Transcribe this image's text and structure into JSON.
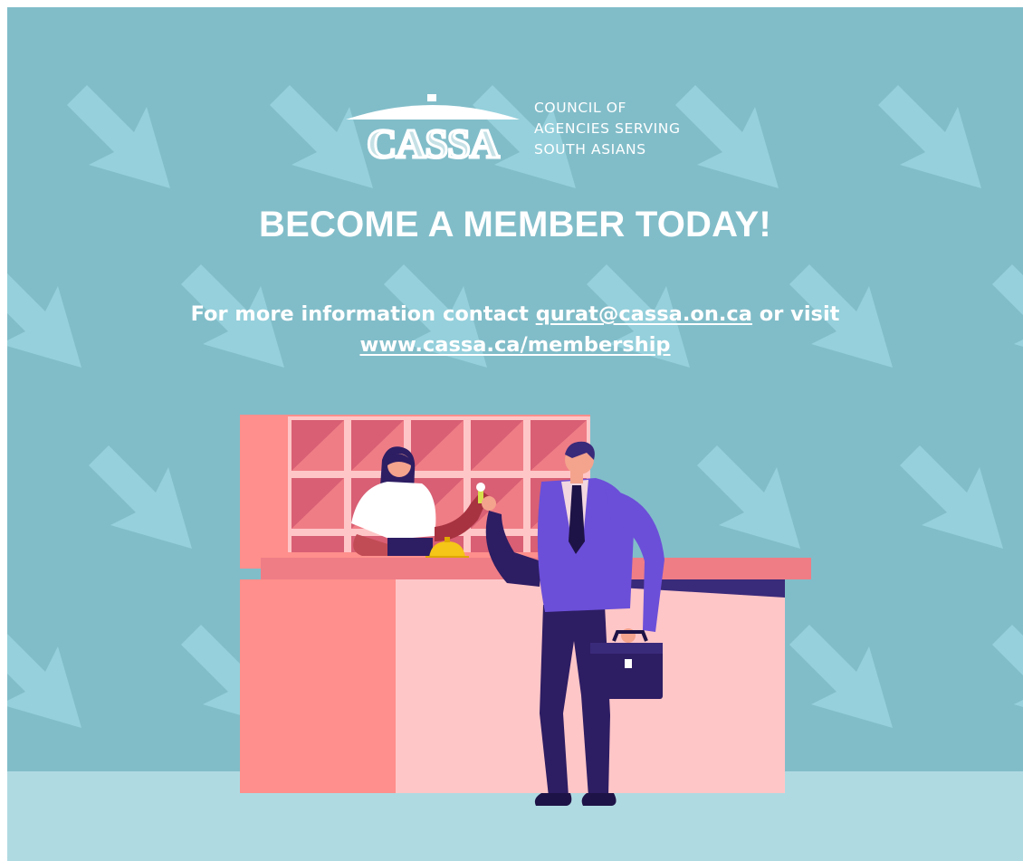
{
  "logo": {
    "wordmark": "CASSA",
    "caption_lines": [
      "COUNCIL OF",
      "AGENCIES SERVING",
      "SOUTH ASIANS"
    ]
  },
  "headline": "BECOME A MEMBER TODAY!",
  "info": {
    "prefix": "For more information contact",
    "email": "qurat@cassa.on.ca",
    "middle": "or visit",
    "url": "www.cassa.ca/membership"
  },
  "colors": {
    "background": "#81bdc9",
    "floor": "#b0dae2",
    "arrow": "#95d0dc",
    "desk": "#ff8f8c",
    "desk_front": "#ffc6c7",
    "suit": "#2d1d63",
    "vest": "#6b4fd8"
  },
  "icons": [
    "arrow-pattern-icon",
    "hotel-bell-icon",
    "briefcase-icon",
    "key-icon"
  ]
}
